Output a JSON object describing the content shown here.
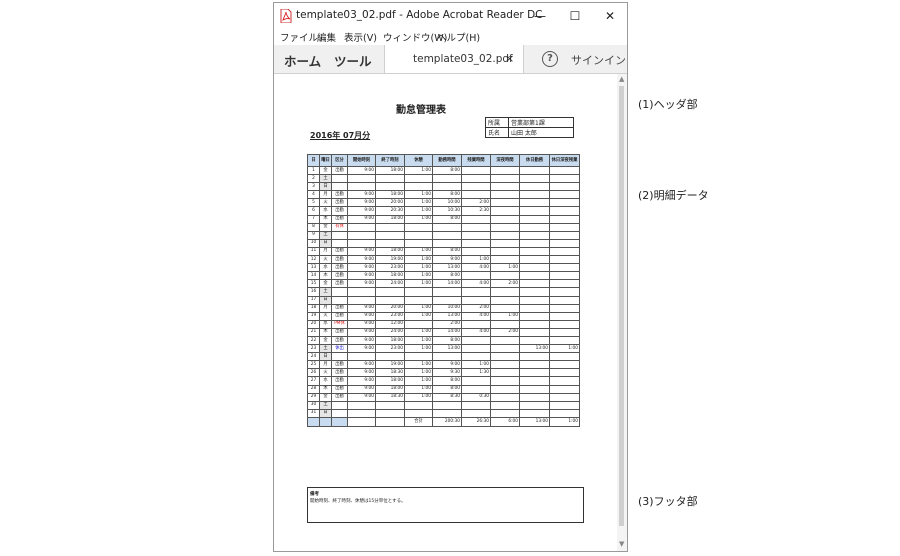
{
  "window": {
    "title": "template03_02.pdf - Adobe Acrobat Reader DC",
    "controls": {
      "minimize": "—",
      "maximize": "☐",
      "close": "✕"
    }
  },
  "menu": [
    "ファイル",
    "編集",
    "表示(V)",
    "ウィンドウ(W)",
    "ヘルプ(H)"
  ],
  "toolbar": {
    "home": "ホーム",
    "tools": "ツール",
    "tab": "template03_02.pdf",
    "tab_close": "×",
    "help": "?",
    "signin": "サインイン"
  },
  "doc": {
    "title": "勤怠管理表",
    "date": "2016年 07月分",
    "info": [
      {
        "label": "所属",
        "value": "営業部第1課"
      },
      {
        "label": "氏名",
        "value": "山田 太郎"
      }
    ],
    "headers": [
      "日",
      "曜日",
      "区分",
      "開始時刻",
      "終了時刻",
      "休憩",
      "勤務時間",
      "残業時間",
      "深夜時間",
      "休日勤務",
      "休日深夜残業"
    ],
    "rows": [
      [
        "1",
        "金",
        "出勤",
        "9:00",
        "18:00",
        "1:00",
        "8:00",
        "",
        "",
        "",
        ""
      ],
      [
        "2",
        "土",
        "",
        "",
        "",
        "",
        "",
        "",
        "",
        "",
        ""
      ],
      [
        "3",
        "日",
        "",
        "",
        "",
        "",
        "",
        "",
        "",
        "",
        ""
      ],
      [
        "4",
        "月",
        "出勤",
        "9:00",
        "18:00",
        "1:00",
        "8:00",
        "",
        "",
        "",
        ""
      ],
      [
        "5",
        "火",
        "出勤",
        "9:00",
        "20:00",
        "1:00",
        "10:00",
        "2:00",
        "",
        "",
        ""
      ],
      [
        "6",
        "水",
        "出勤",
        "9:00",
        "20:30",
        "1:00",
        "10:30",
        "2:30",
        "",
        "",
        ""
      ],
      [
        "7",
        "木",
        "出勤",
        "9:00",
        "18:00",
        "1:00",
        "8:00",
        "",
        "",
        "",
        ""
      ],
      [
        "8",
        "金",
        "有休",
        "",
        "",
        "",
        "",
        "",
        "",
        "",
        ""
      ],
      [
        "9",
        "土",
        "",
        "",
        "",
        "",
        "",
        "",
        "",
        "",
        ""
      ],
      [
        "10",
        "日",
        "",
        "",
        "",
        "",
        "",
        "",
        "",
        "",
        ""
      ],
      [
        "11",
        "月",
        "出勤",
        "9:00",
        "18:00",
        "1:00",
        "8:00",
        "",
        "",
        "",
        ""
      ],
      [
        "12",
        "火",
        "出勤",
        "9:00",
        "19:00",
        "1:00",
        "9:00",
        "1:00",
        "",
        "",
        ""
      ],
      [
        "13",
        "水",
        "出勤",
        "9:00",
        "23:00",
        "1:00",
        "13:00",
        "4:00",
        "1:00",
        "",
        ""
      ],
      [
        "14",
        "木",
        "出勤",
        "9:00",
        "18:00",
        "1:00",
        "8:00",
        "",
        "",
        "",
        ""
      ],
      [
        "15",
        "金",
        "出勤",
        "9:00",
        "24:00",
        "1:00",
        "14:00",
        "4:00",
        "2:00",
        "",
        ""
      ],
      [
        "16",
        "土",
        "",
        "",
        "",
        "",
        "",
        "",
        "",
        "",
        ""
      ],
      [
        "17",
        "日",
        "",
        "",
        "",
        "",
        "",
        "",
        "",
        "",
        ""
      ],
      [
        "18",
        "月",
        "出勤",
        "9:00",
        "20:00",
        "1:00",
        "10:00",
        "2:00",
        "",
        "",
        ""
      ],
      [
        "19",
        "火",
        "出勤",
        "9:00",
        "23:00",
        "1:00",
        "13:00",
        "4:00",
        "1:00",
        "",
        ""
      ],
      [
        "20",
        "水",
        "PM休",
        "9:00",
        "12:00",
        "",
        "2:00",
        "",
        "",
        "",
        ""
      ],
      [
        "21",
        "木",
        "出勤",
        "9:00",
        "24:00",
        "1:00",
        "14:00",
        "4:00",
        "2:00",
        "",
        ""
      ],
      [
        "22",
        "金",
        "出勤",
        "9:00",
        "18:00",
        "1:00",
        "8:00",
        "",
        "",
        "",
        ""
      ],
      [
        "23",
        "土",
        "休出",
        "9:00",
        "23:00",
        "1:00",
        "13:00",
        "",
        "",
        "13:00",
        "1:00"
      ],
      [
        "24",
        "日",
        "",
        "",
        "",
        "",
        "",
        "",
        "",
        "",
        ""
      ],
      [
        "25",
        "月",
        "出勤",
        "9:00",
        "19:00",
        "1:00",
        "9:00",
        "1:00",
        "",
        "",
        ""
      ],
      [
        "26",
        "火",
        "出勤",
        "9:00",
        "18:30",
        "1:00",
        "9:30",
        "1:30",
        "",
        "",
        ""
      ],
      [
        "27",
        "水",
        "出勤",
        "9:00",
        "18:00",
        "1:00",
        "8:00",
        "",
        "",
        "",
        ""
      ],
      [
        "28",
        "木",
        "出勤",
        "9:00",
        "18:00",
        "1:00",
        "8:00",
        "",
        "",
        "",
        ""
      ],
      [
        "29",
        "金",
        "出勤",
        "9:00",
        "18:30",
        "1:00",
        "8:30",
        "0:30",
        "",
        "",
        ""
      ],
      [
        "30",
        "土",
        "",
        "",
        "",
        "",
        "",
        "",
        "",
        "",
        ""
      ],
      [
        "31",
        "日",
        "",
        "",
        "",
        "",
        "",
        "",
        "",
        "",
        ""
      ]
    ],
    "totals": {
      "label": "合計",
      "work": "200:30",
      "overtime": "26:30",
      "night": "6:00",
      "holiday": "13:00",
      "holiday_night": "1:00"
    },
    "remarks": {
      "title": "備考",
      "text": "開始時刻、終了時刻、休憩は15分単位とする。"
    }
  },
  "annotations": {
    "header": "(1)ヘッダ部",
    "detail": "(2)明細データ",
    "footer": "(3)フッタ部"
  },
  "colors": {
    "header_fill": "#c9dcef",
    "weekend_fill": "#e6e6e6",
    "leave": "#e01010",
    "holiday_work": "#1010d0"
  },
  "icons": {
    "file": "pdf-icon",
    "help": "help-icon"
  }
}
